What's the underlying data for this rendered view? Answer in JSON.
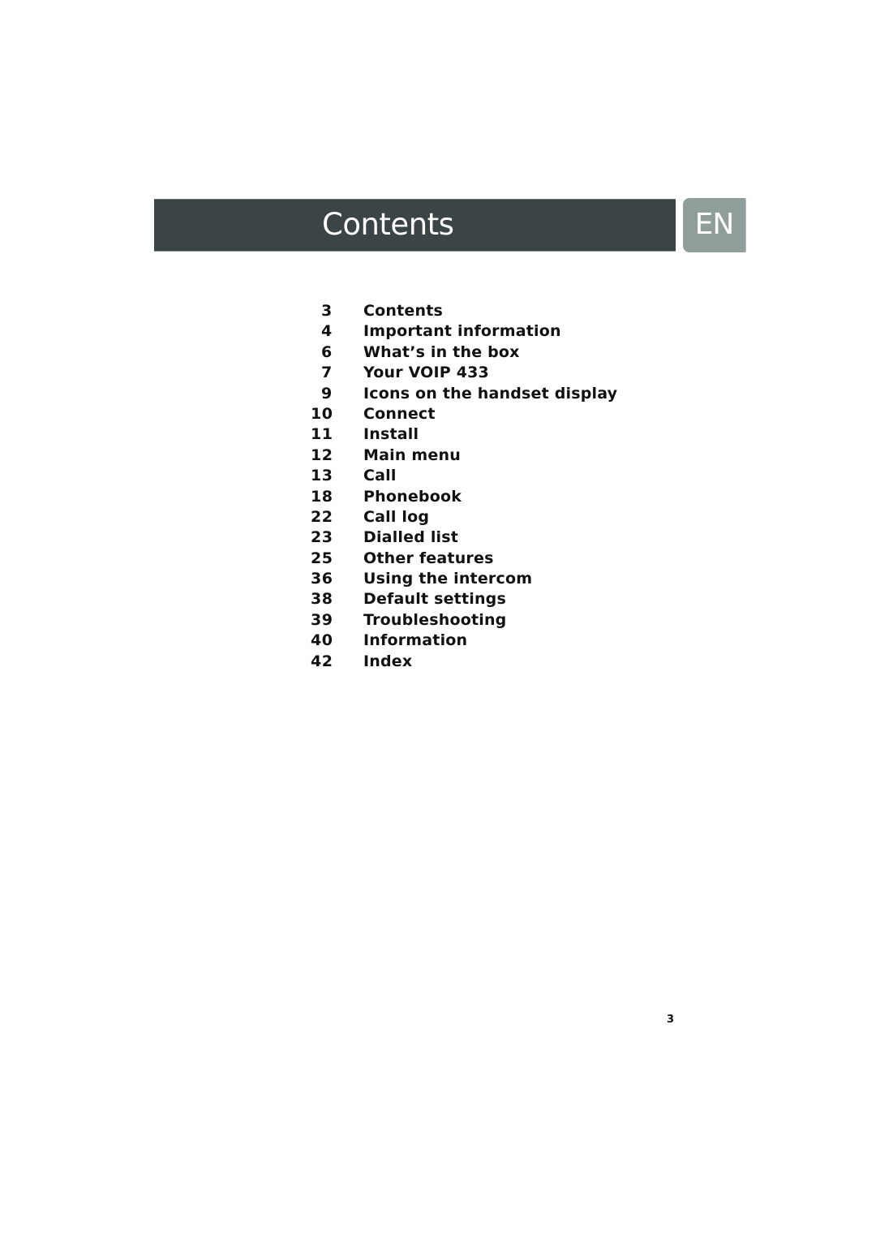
{
  "header": {
    "title": "Contents",
    "language_tab": "EN"
  },
  "colors": {
    "header_bar": "#3b4446",
    "language_tab": "#8f9e9b",
    "text": "#111111"
  },
  "toc": {
    "entries": [
      {
        "page": "3",
        "title": "Contents"
      },
      {
        "page": "4",
        "title": "Important information"
      },
      {
        "page": "6",
        "title": "What’s in the box"
      },
      {
        "page": "7",
        "title": "Your VOIP 433"
      },
      {
        "page": "9",
        "title": "Icons on the handset display"
      },
      {
        "page": "10",
        "title": "Connect"
      },
      {
        "page": "11",
        "title": "Install"
      },
      {
        "page": "12",
        "title": "Main menu"
      },
      {
        "page": "13",
        "title": "Call"
      },
      {
        "page": "18",
        "title": "Phonebook"
      },
      {
        "page": "22",
        "title": "Call log"
      },
      {
        "page": "23",
        "title": "Dialled list"
      },
      {
        "page": "25",
        "title": "Other features"
      },
      {
        "page": "36",
        "title": "Using the intercom"
      },
      {
        "page": "38",
        "title": "Default settings"
      },
      {
        "page": "39",
        "title": "Troubleshooting"
      },
      {
        "page": "40",
        "title": "Information"
      },
      {
        "page": "42",
        "title": "Index"
      }
    ]
  },
  "footer": {
    "page_number": "3"
  }
}
